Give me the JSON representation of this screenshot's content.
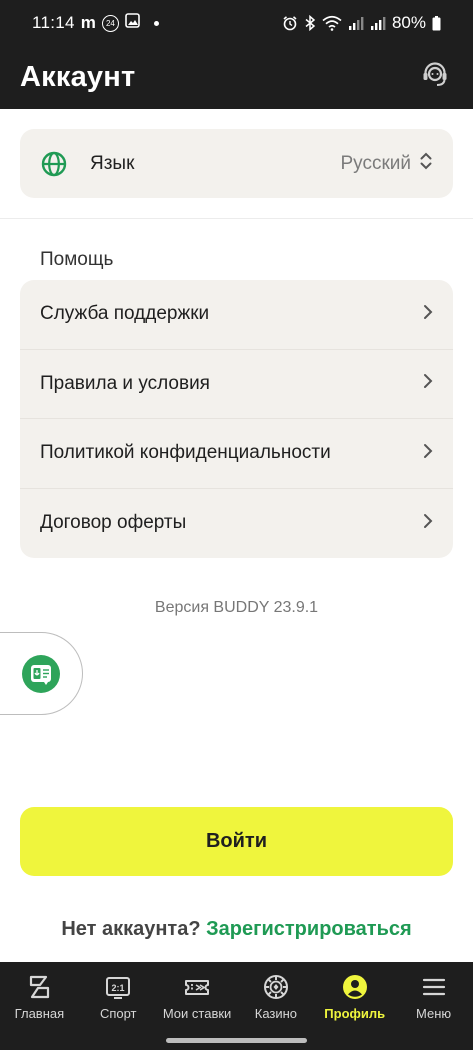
{
  "status_bar": {
    "time": "11:14",
    "m_icon": "m",
    "badge_24": "24",
    "battery": "80%"
  },
  "header": {
    "title": "Аккаунт",
    "support_icon": "headset-icon"
  },
  "language": {
    "label": "Язык",
    "value": "Русский",
    "icon": "globe-icon"
  },
  "help": {
    "title": "Помощь",
    "items": [
      {
        "label": "Служба поддержки"
      },
      {
        "label": "Правила и условия"
      },
      {
        "label": "Политикой конфиденциальности"
      },
      {
        "label": "Договор оферты"
      }
    ]
  },
  "version": "Версия BUDDY 23.9.1",
  "login_label": "Войти",
  "register": {
    "question": "Нет аккаунта?",
    "link": "Зарегистрироваться"
  },
  "bottom_nav": [
    {
      "label": "Главная",
      "icon": "home-icon"
    },
    {
      "label": "Спорт",
      "icon": "scoreboard-icon"
    },
    {
      "label": "Мои ставки",
      "icon": "ticket-icon"
    },
    {
      "label": "Казино",
      "icon": "casino-chip-icon"
    },
    {
      "label": "Профиль",
      "icon": "profile-icon",
      "active": true
    },
    {
      "label": "Меню",
      "icon": "menu-icon"
    }
  ],
  "colors": {
    "accent_yellow": "#eff53d",
    "link_green": "#1f9a54",
    "dark_bg": "#1e1e1e",
    "card_bg": "#f3f1ed"
  }
}
